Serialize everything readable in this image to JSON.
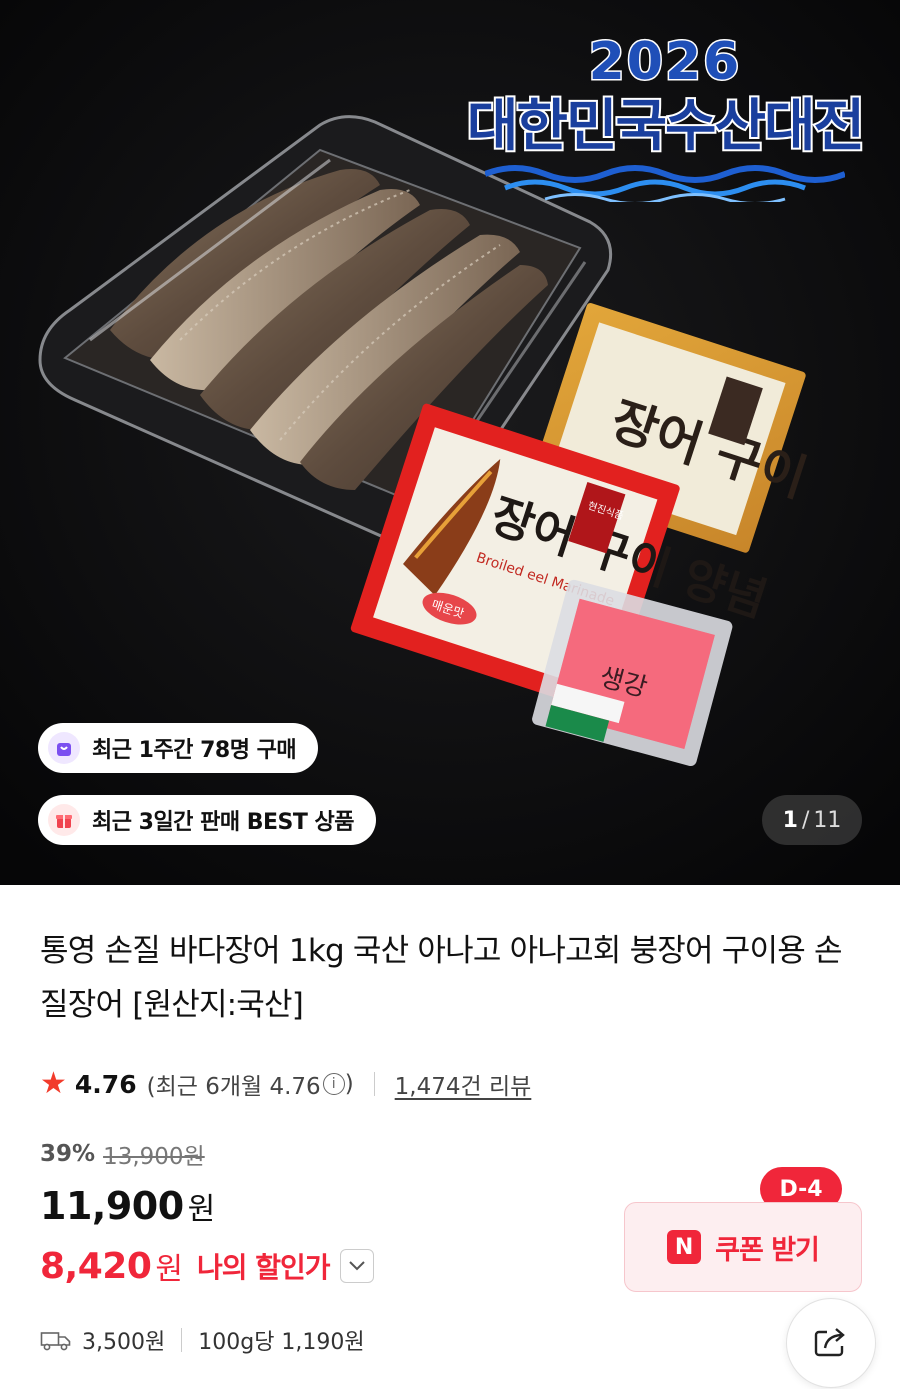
{
  "event_logo": {
    "year": "2026",
    "title": "대한민국수산대전"
  },
  "badges": [
    {
      "text": "최근 1주간 78명 구매",
      "icon": "shopping-bag-icon"
    },
    {
      "text": "최근 3일간 판매 BEST 상품",
      "icon": "gift-box-icon"
    }
  ],
  "image_counter": {
    "current": "1",
    "separator": "/",
    "total": "11"
  },
  "product": {
    "title": "통영 손질 바다장어 1kg 국산 아나고 아나고회 붕장어 구이용 손질장어 [원산지:국산]"
  },
  "rating": {
    "score": "4.76",
    "recent_text": "(최근 6개월 4.76",
    "recent_close": ")",
    "info_glyph": "i",
    "reviews": "1,474건 리뷰",
    "star_color": "#f23b2b"
  },
  "pricing": {
    "discount_pct": "39%",
    "original_price": "13,900원",
    "sale_price": "11,900",
    "currency": "원",
    "my_price": "8,420",
    "my_price_label": "나의 할인가",
    "accent_color": "#f0263a"
  },
  "coupon": {
    "logo_letter": "N",
    "label": "쿠폰 받기",
    "dday": "D-4"
  },
  "shipping": {
    "fee": "3,500원",
    "unit_price": "100g당 1,190원"
  },
  "product_photo": {
    "sauce_red_title": "장어 구이 양념",
    "sauce_red_brand": "현진식품",
    "sauce_red_sub": "Broiled eel Marinade",
    "sauce_red_tag": "매운맛",
    "sauce_yellow_title": "장어 구이",
    "ginger_label": "생강"
  }
}
